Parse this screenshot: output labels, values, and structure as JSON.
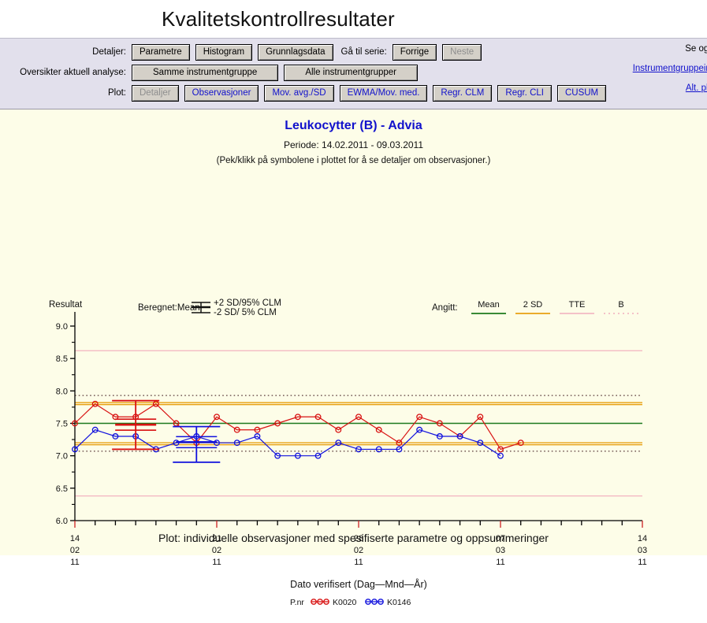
{
  "header": {
    "title": "Kvalitetskontrollresultater"
  },
  "toolbar": {
    "row1": {
      "label": "Detaljer:",
      "buttons": [
        "Parametre",
        "Histogram",
        "Grunnlagsdata"
      ],
      "goto_label": "Gå til serie:",
      "prev": "Forrige",
      "next": "Neste"
    },
    "row2": {
      "label": "Oversikter aktuell analyse:",
      "buttons": [
        "Samme instrumentgruppe",
        "Alle instrumentgrupper"
      ]
    },
    "row3": {
      "label": "Plot:",
      "buttons": [
        "Detaljer",
        "Observasjoner",
        "Mov. avg./SD",
        "EWMA/Mov. med.",
        "Regr. CLM",
        "Regr. CLI",
        "CUSUM"
      ]
    },
    "links": {
      "see_also": "Se ogs",
      "instrument_group_info": "Instrumentgruppeinf",
      "alt_plot": "Alt. plo"
    }
  },
  "chart_header": {
    "title": "Leukocytter (B) - Advia",
    "period": "Periode: 14.02.2011 - 09.03.2011",
    "hint": "(Pek/klikk på symbolene i plottet for å se detaljer om observasjoner.)"
  },
  "footer": {
    "note": "Plot: individuelle observasjoner med spesifiserte parametre og oppsummeringer"
  },
  "chart_data": {
    "type": "line",
    "title": "Leukocytter (B) - Advia",
    "xlabel": "Dato verifisert (Dag—Mnd—År)",
    "ylabel": "Resultat",
    "ylim": [
      6.0,
      9.0
    ],
    "yticks": [
      "6.0",
      "6.5",
      "7.0",
      "7.5",
      "8.0",
      "8.5",
      "9.0"
    ],
    "grid": false,
    "xtick_labels": [
      {
        "day": "14",
        "month": "02",
        "year": "11"
      },
      {
        "day": "21",
        "month": "02",
        "year": "11"
      },
      {
        "day": "28",
        "month": "02",
        "year": "11"
      },
      {
        "day": "07",
        "month": "03",
        "year": "11"
      },
      {
        "day": "14",
        "month": "03",
        "year": "11"
      }
    ],
    "calc_legend": {
      "label": "Beregnet:",
      "mean": "Mean",
      "upper": "+2 SD/95% CLM",
      "lower": "-2 SD/ 5% CLM"
    },
    "spec_legend": {
      "label": "Angitt:",
      "items": [
        {
          "name": "Mean",
          "color": "#1d7a1d",
          "style": "solid"
        },
        {
          "name": "2 SD",
          "color": "#e8a112",
          "style": "solid"
        },
        {
          "name": "TTE",
          "color": "#f3b9c4",
          "style": "solid"
        },
        {
          "name": "B",
          "color": "#f3b9c4",
          "style": "dotted"
        }
      ]
    },
    "reference_lines": [
      {
        "name": "TTE upper",
        "value": 8.62,
        "color": "#f3b9c4",
        "style": "solid"
      },
      {
        "name": "B upper",
        "value": 7.93,
        "color": "#5a3a3a",
        "style": "dotted"
      },
      {
        "name": "2 SD upper",
        "value": 7.82,
        "color": "#e8a112",
        "style": "solid"
      },
      {
        "name": "2 SD upper 2",
        "value": 7.79,
        "color": "#e8a112",
        "style": "solid"
      },
      {
        "name": "Mean",
        "value": 7.5,
        "color": "#1d7a1d",
        "style": "solid"
      },
      {
        "name": "2 SD lower",
        "value": 7.2,
        "color": "#e8a112",
        "style": "solid"
      },
      {
        "name": "2 SD lower 2",
        "value": 7.17,
        "color": "#e8a112",
        "style": "solid"
      },
      {
        "name": "B lower",
        "value": 7.07,
        "color": "#5a3a3a",
        "style": "dotted"
      },
      {
        "name": "TTE lower",
        "value": 6.38,
        "color": "#f3b9c4",
        "style": "solid"
      }
    ],
    "series": [
      {
        "name": "K0020",
        "color": "#d81111",
        "marker": "circle",
        "values": [
          7.5,
          7.8,
          7.6,
          7.6,
          7.8,
          7.5,
          7.2,
          7.6,
          7.4,
          7.4,
          7.5,
          7.6,
          7.6,
          7.4,
          7.6,
          7.4,
          7.2,
          7.6,
          7.5,
          7.3,
          7.6,
          7.1,
          7.2
        ]
      },
      {
        "name": "K0146",
        "color": "#1111dd",
        "marker": "circle",
        "values": [
          7.1,
          7.4,
          7.3,
          7.3,
          7.1,
          7.2,
          7.3,
          7.2,
          7.2,
          7.3,
          7.0,
          7.0,
          7.0,
          7.2,
          7.1,
          7.1,
          7.1,
          7.4,
          7.3,
          7.3,
          7.2,
          7.0
        ]
      }
    ],
    "summaries": [
      {
        "series": "K0020",
        "color": "#d81111",
        "index": 3,
        "mean": 7.48,
        "upper": 7.85,
        "lower": 7.1
      },
      {
        "series": "K0146",
        "color": "#1111dd",
        "index": 6,
        "mean": 7.21,
        "upper": 7.45,
        "lower": 6.9
      }
    ],
    "pnr_legend": {
      "label": "P.nr",
      "entries": [
        {
          "code": "K0020",
          "color": "#d81111"
        },
        {
          "code": "K0146",
          "color": "#1111dd"
        }
      ]
    }
  }
}
